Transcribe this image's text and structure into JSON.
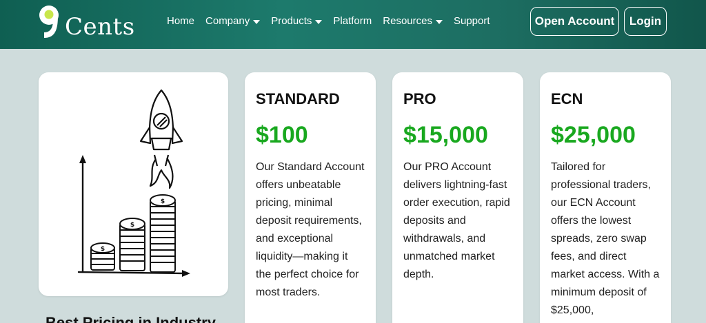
{
  "header": {
    "logo_text": "Cents",
    "nav": [
      {
        "label": "Home",
        "dropdown": false
      },
      {
        "label": "Company",
        "dropdown": true
      },
      {
        "label": "Products",
        "dropdown": true
      },
      {
        "label": "Platform",
        "dropdown": false
      },
      {
        "label": "Resources",
        "dropdown": true
      },
      {
        "label": "Support",
        "dropdown": false
      }
    ],
    "open_account_label": "Open Account",
    "login_label": "Login",
    "colors": {
      "header_bg": "#1d7a6c",
      "logo_accent": "#c8e64b"
    }
  },
  "plans": [
    {
      "name": "STANDARD",
      "price": "$100",
      "description": "Our Standard Account offers unbeatable pricing, minimal deposit requirements, and exceptional liquidity—making it the perfect choice for most traders."
    },
    {
      "name": "PRO",
      "price": "$15,000",
      "description": "Our PRO Account delivers lightning-fast order execution, rapid deposits and withdrawals, and unmatched market depth."
    },
    {
      "name": "ECN",
      "price": "$25,000",
      "description": "Tailored for professional traders, our ECN Account offers the lowest spreads, zero swap fees, and direct market access. With a minimum deposit of $25,000,"
    }
  ],
  "illustration": {
    "icon": "rocket-coins-growth-icon"
  },
  "bottom_heading": "Best Pricing in Industry",
  "colors": {
    "price_green": "#19a81f",
    "page_bg": "#cfdcdc"
  }
}
